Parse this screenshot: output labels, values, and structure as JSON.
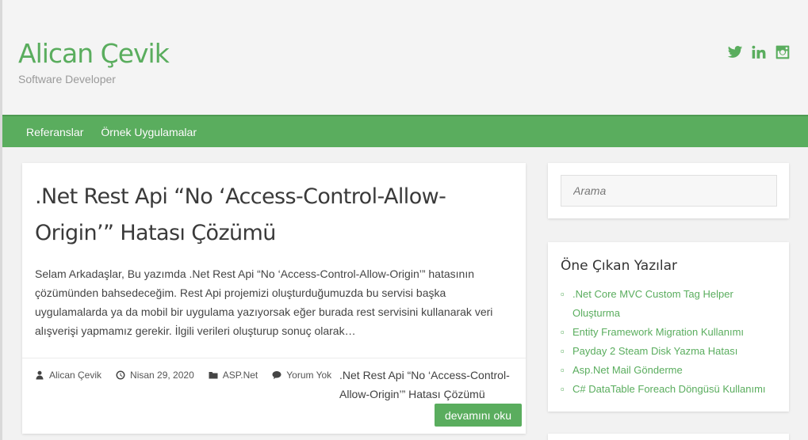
{
  "header": {
    "title": "Alican Çevik",
    "description": "Software Developer",
    "social": [
      "twitter-icon",
      "linkedin-icon",
      "instagram-icon"
    ]
  },
  "nav": {
    "items": [
      {
        "label": "Referanslar"
      },
      {
        "label": "Örnek Uygulamalar"
      }
    ]
  },
  "post": {
    "title": ".Net Rest Api “No ‘Access-Control-Allow-Origin’” Hatası Çözümü",
    "excerpt": "Selam Arkadaşlar, Bu yazımda .Net Rest Api “No ‘Access-Control-Allow-Origin’” hatasının çözümünden bahsedeceğim. Rest Api projemizi oluşturduğumuzda bu servisi başka uygulamalarda ya da mobil bir uygulama yazıyorsak eğer burada rest servisini kullanarak veri alışverişi yapmamız gerekir. İlgili verileri oluşturup sonuç olarak…",
    "meta": {
      "author": "Alican Çevik",
      "date": "Nisan 29, 2020",
      "category": "ASP.Net",
      "comments": "Yorum Yok"
    },
    "meta_title": ".Net Rest Api “No ‘Access-Control-Allow-Origin’” Hatası Çözümü",
    "read_more": "devamını oku"
  },
  "sidebar": {
    "search": {
      "placeholder": "Arama"
    },
    "featured": {
      "title": "Öne Çıkan Yazılar",
      "items": [
        ".Net Core MVC Custom Tag Helper Oluşturma",
        "Entity Framework Migration Kullanımı",
        "Payday 2 Steam Disk Yazma Hatası",
        "Asp.Net Mail Gönderme",
        "C# DataTable Foreach Döngüsü Kullanımı"
      ]
    }
  },
  "colors": {
    "accent": "#5aad5e",
    "background": "#f2f2f2"
  }
}
